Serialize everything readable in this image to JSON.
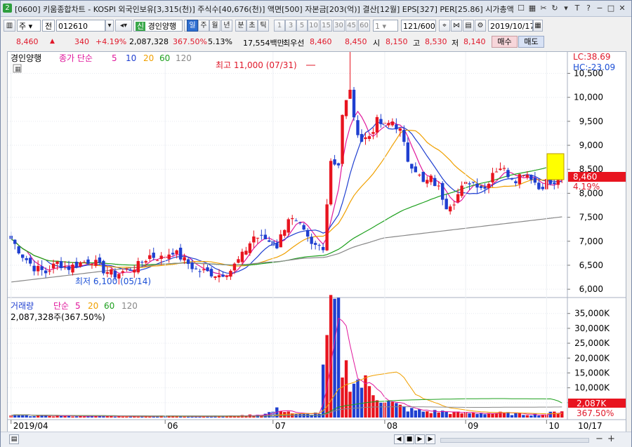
{
  "titlebar": {
    "window_number": "2",
    "title": "[0600] 키움종합차트 - KOSPI 외국인보유[3,315(천)] 주식수[40,676(천)] 액면[500] 자본금[203(억)] 결산[12월] EPS[327] PER[25.86] 시가총액"
  },
  "toolbar1": {
    "market": "주",
    "all": "전",
    "code": "012610",
    "credit_badge": "신",
    "stock_name": "경인양행",
    "periods": [
      "일",
      "주",
      "월",
      "년",
      "분",
      "초",
      "틱"
    ],
    "minutes": [
      "1",
      "3",
      "5",
      "10",
      "15",
      "30",
      "45",
      "60"
    ],
    "interval": "1",
    "count": "121/600",
    "date": "2019/10/17"
  },
  "toolbar2": {
    "price": "8,460",
    "change": "340",
    "change_pct": "+4.19%",
    "volume": "2,087,328",
    "volume_ratio": "367.50%",
    "turnover": "5.13%",
    "amount": "17,554백만",
    "best_bid_label": "최우선",
    "ask": "8,460",
    "bid": "8,450",
    "open_label": "시",
    "open": "8,150",
    "high_label": "고",
    "high": "8,530",
    "low_label": "저",
    "low": "8,140",
    "buy": "매수",
    "sell": "매도"
  },
  "price_panel": {
    "name": "경인양행",
    "ma_label": "종가 단순",
    "ma_periods": [
      "5",
      "10",
      "20",
      "60",
      "120"
    ],
    "lc": "LC:38.69",
    "hc": "HC:-23.09",
    "high_annotation": "최고 11,000 (07/31)",
    "low_annotation": "최저 6,100 (05/14)",
    "last_price": "8,460",
    "last_pct": "4.19%",
    "y_ticks": [
      "10,500",
      "10,000",
      "9,500",
      "9,000",
      "8,500",
      "8,000",
      "7,500",
      "7,000",
      "6,500",
      "6,000"
    ]
  },
  "volume_panel": {
    "name": "거래량",
    "ma_label": "단순",
    "ma_periods": [
      "5",
      "20",
      "60",
      "120"
    ],
    "current": "2,087,328주(367.50%)",
    "last_volume": "2,087K",
    "last_pct": "367.50%",
    "y_ticks": [
      "35,000K",
      "30,000K",
      "25,000K",
      "20,000K",
      "15,000K",
      "10,000K",
      "5,000K"
    ]
  },
  "x_axis": {
    "labels": [
      "2019/04",
      "06",
      "07",
      "08",
      "09",
      "10",
      "10/17"
    ]
  },
  "colors": {
    "up": "#e8141f",
    "down": "#1f3fd0",
    "ma5": "#e0189c",
    "ma10": "#1f3fd0",
    "ma20": "#f0a000",
    "ma60": "#1ea01e",
    "ma120": "#888888"
  },
  "bottombar": {
    "controls": [
      "◀",
      "■",
      "▶",
      "▶"
    ],
    "zoom": [
      "−",
      "+"
    ]
  },
  "chart_data": {
    "type": "candlestick",
    "title": "경인양행",
    "x_range": [
      "2019/04",
      "2019/10/17"
    ],
    "ylim": [
      5900,
      10800
    ],
    "price_high": 11000,
    "price_low": 6100,
    "close_path": [
      [
        0,
        7050
      ],
      [
        3,
        6700
      ],
      [
        6,
        6450
      ],
      [
        9,
        6350
      ],
      [
        12,
        6550
      ],
      [
        15,
        6450
      ],
      [
        18,
        6550
      ],
      [
        21,
        6600
      ],
      [
        24,
        6400
      ],
      [
        27,
        6300
      ],
      [
        30,
        6400
      ],
      [
        33,
        6500
      ],
      [
        36,
        6700
      ],
      [
        39,
        6650
      ],
      [
        42,
        6800
      ],
      [
        45,
        6600
      ],
      [
        48,
        6400
      ],
      [
        51,
        6350
      ],
      [
        54,
        6300
      ],
      [
        57,
        6400
      ],
      [
        60,
        6700
      ],
      [
        63,
        7100
      ],
      [
        66,
        7050
      ],
      [
        69,
        6900
      ],
      [
        72,
        7500
      ],
      [
        75,
        7300
      ],
      [
        78,
        6900
      ],
      [
        81,
        6900
      ],
      [
        83,
        8700
      ],
      [
        85,
        8600
      ],
      [
        86,
        9600
      ],
      [
        88,
        10200
      ],
      [
        89,
        9500
      ],
      [
        91,
        9100
      ],
      [
        93,
        9200
      ],
      [
        95,
        9500
      ],
      [
        97,
        9400
      ],
      [
        99,
        9500
      ],
      [
        101,
        9300
      ],
      [
        103,
        8700
      ],
      [
        105,
        8500
      ],
      [
        107,
        8200
      ],
      [
        109,
        8300
      ],
      [
        111,
        8100
      ],
      [
        113,
        7750
      ],
      [
        115,
        7850
      ],
      [
        117,
        8100
      ],
      [
        119,
        8250
      ],
      [
        121,
        8200
      ],
      [
        123,
        8100
      ],
      [
        125,
        8450
      ],
      [
        127,
        8550
      ],
      [
        129,
        8400
      ],
      [
        131,
        8300
      ],
      [
        133,
        8450
      ],
      [
        135,
        8350
      ],
      [
        137,
        8100
      ],
      [
        139,
        8250
      ],
      [
        141,
        8150
      ],
      [
        143,
        8460
      ]
    ],
    "volume_path": [
      [
        0,
        800
      ],
      [
        10,
        600
      ],
      [
        20,
        500
      ],
      [
        30,
        400
      ],
      [
        40,
        500
      ],
      [
        50,
        400
      ],
      [
        60,
        600
      ],
      [
        66,
        1200
      ],
      [
        70,
        3000
      ],
      [
        74,
        1000
      ],
      [
        80,
        1500
      ],
      [
        82,
        25000
      ],
      [
        84,
        35000
      ],
      [
        85,
        30000
      ],
      [
        86,
        18000
      ],
      [
        88,
        14000
      ],
      [
        90,
        12000
      ],
      [
        92,
        11000
      ],
      [
        94,
        9000
      ],
      [
        96,
        7000
      ],
      [
        98,
        5000
      ],
      [
        100,
        4000
      ],
      [
        104,
        2500
      ],
      [
        108,
        2000
      ],
      [
        112,
        2000
      ],
      [
        116,
        1500
      ],
      [
        120,
        1500
      ],
      [
        126,
        1500
      ],
      [
        132,
        1200
      ],
      [
        138,
        1000
      ],
      [
        143,
        2087
      ]
    ],
    "series": [
      {
        "name": "5",
        "type": "line"
      },
      {
        "name": "10",
        "type": "line"
      },
      {
        "name": "20",
        "type": "line"
      },
      {
        "name": "60",
        "type": "line"
      },
      {
        "name": "120",
        "type": "line"
      }
    ]
  }
}
